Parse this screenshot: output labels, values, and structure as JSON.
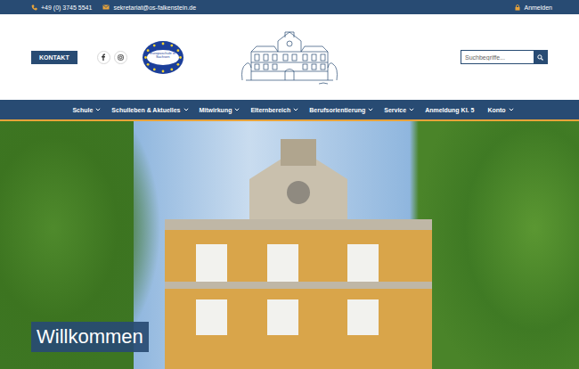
{
  "topbar": {
    "phone": "+49 (0) 3745 5541",
    "email": "sekretariat@os-falkenstein.de",
    "login": "Anmelden"
  },
  "header": {
    "contact_button": "KONTAKT",
    "logo_text": "Europaschule in Sachsen",
    "search": {
      "placeholder": "Suchbegriffe..."
    }
  },
  "nav": [
    {
      "label": "Schule",
      "has_submenu": true
    },
    {
      "label": "Schulleben & Aktuelles",
      "has_submenu": true
    },
    {
      "label": "Mitwirkung",
      "has_submenu": true
    },
    {
      "label": "Elternbereich",
      "has_submenu": true
    },
    {
      "label": "Berufsorientierung",
      "has_submenu": true
    },
    {
      "label": "Service",
      "has_submenu": true
    },
    {
      "label": "Anmeldung Kl. 5",
      "has_submenu": false
    },
    {
      "label": "Konto",
      "has_submenu": true
    }
  ],
  "hero": {
    "title": "Willkommen"
  }
}
